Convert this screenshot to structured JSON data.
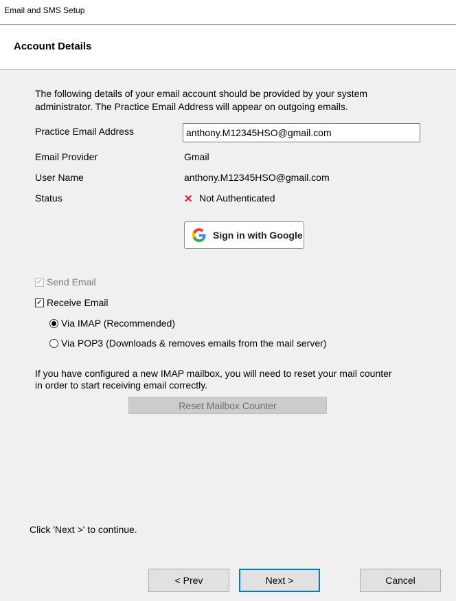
{
  "window": {
    "title": "Email and SMS Setup"
  },
  "header": {
    "heading": "Account Details"
  },
  "intro": "The following details of your email account should be provided by your system administrator. The Practice Email Address will appear on outgoing emails.",
  "fields": {
    "practice_email_label": "Practice Email Address",
    "practice_email_value": "anthony.M12345HSO@gmail.com",
    "provider_label": "Email Provider",
    "provider_value": "Gmail",
    "username_label": "User Name",
    "username_value": "anthony.M12345HSO@gmail.com",
    "status_label": "Status",
    "status_value": "Not Authenticated",
    "status_icon": "x-mark-icon",
    "status_color": "#e81123"
  },
  "google_button": {
    "label": "Sign in with Google",
    "icon": "google-g-icon"
  },
  "options": {
    "send_email": {
      "label": "Send Email",
      "checked": true,
      "disabled": true
    },
    "receive_email": {
      "label": "Receive Email",
      "checked": true
    },
    "via_imap": {
      "label": "Via IMAP (Recommended)",
      "selected": true
    },
    "via_pop3": {
      "label": "Via POP3 (Downloads & removes emails from the mail server)",
      "selected": false
    }
  },
  "reset_note": "If you have configured a new IMAP mailbox, you will need to reset your mail counter in order to start receiving email correctly.",
  "reset_button": {
    "label": "Reset Mailbox Counter",
    "disabled": true
  },
  "footer_note": "Click 'Next >' to continue.",
  "nav": {
    "prev": "< Prev",
    "next": "Next >",
    "cancel": "Cancel"
  },
  "colors": {
    "accent": "#0078d7",
    "background": "#f0f0f0"
  }
}
